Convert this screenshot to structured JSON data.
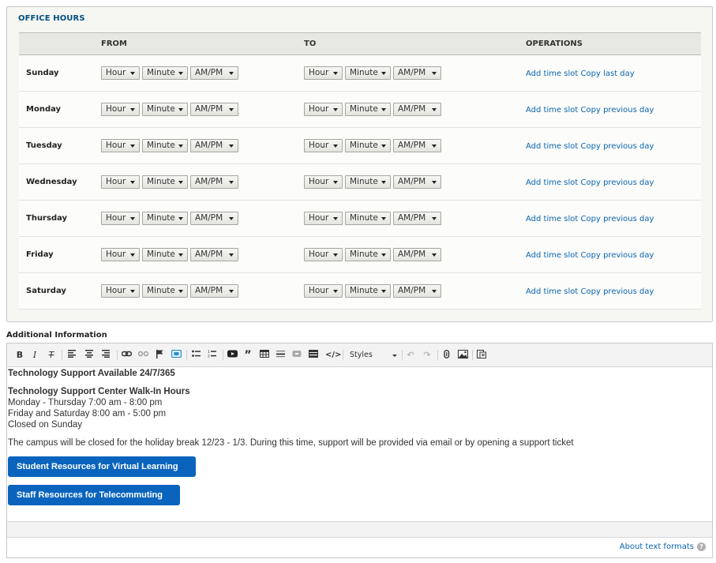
{
  "office_hours": {
    "legend": "OFFICE HOURS",
    "headers": {
      "day": "",
      "from": "FROM",
      "to": "TO",
      "operations": "OPERATIONS"
    },
    "select_defaults": {
      "hour": "Hour",
      "minute": "Minute",
      "ampm": "AM/PM"
    },
    "rows": [
      {
        "day": "Sunday",
        "add": "Add time slot",
        "copy": "Copy last day"
      },
      {
        "day": "Monday",
        "add": "Add time slot",
        "copy": "Copy previous day"
      },
      {
        "day": "Tuesday",
        "add": "Add time slot",
        "copy": "Copy previous day"
      },
      {
        "day": "Wednesday",
        "add": "Add time slot",
        "copy": "Copy previous day"
      },
      {
        "day": "Thursday",
        "add": "Add time slot",
        "copy": "Copy previous day"
      },
      {
        "day": "Friday",
        "add": "Add time slot",
        "copy": "Copy previous day"
      },
      {
        "day": "Saturday",
        "add": "Add time slot",
        "copy": "Copy previous day"
      }
    ]
  },
  "additional_info": {
    "label": "Additional Information",
    "toolbar": {
      "styles_label": "Styles",
      "buttons": [
        "bold",
        "italic",
        "remove-format",
        "align-left",
        "align-center",
        "align-right",
        "link",
        "unlink",
        "anchor",
        "iframe",
        "bulleted-list",
        "numbered-list",
        "youtube",
        "blockquote",
        "table",
        "horizontal-line",
        "button-widget",
        "accordion",
        "source",
        "styles",
        "undo",
        "redo",
        "media",
        "image",
        "templates"
      ]
    },
    "content": {
      "line1": "Technology Support Available 24/7/365",
      "heading2": "Technology Support Center Walk-In Hours",
      "line3": "Monday - Thursday 7:00 am - 8:00 pm",
      "line4": "Friday and Saturday 8:00 am - 5:00 pm",
      "line5": "Closed on Sunday",
      "line6": "The campus will be closed for the holiday break 12/23 - 1/3. During this time, support will be provided via email or by opening a support ticket",
      "button1": "Student Resources for Virtual Learning",
      "button2": "Staff Resources for Telecommuting"
    },
    "about_formats": "About text formats",
    "help_icon": "?"
  },
  "colors": {
    "link": "#0a65b0",
    "button": "#0a64be",
    "legend": "#004f80"
  }
}
